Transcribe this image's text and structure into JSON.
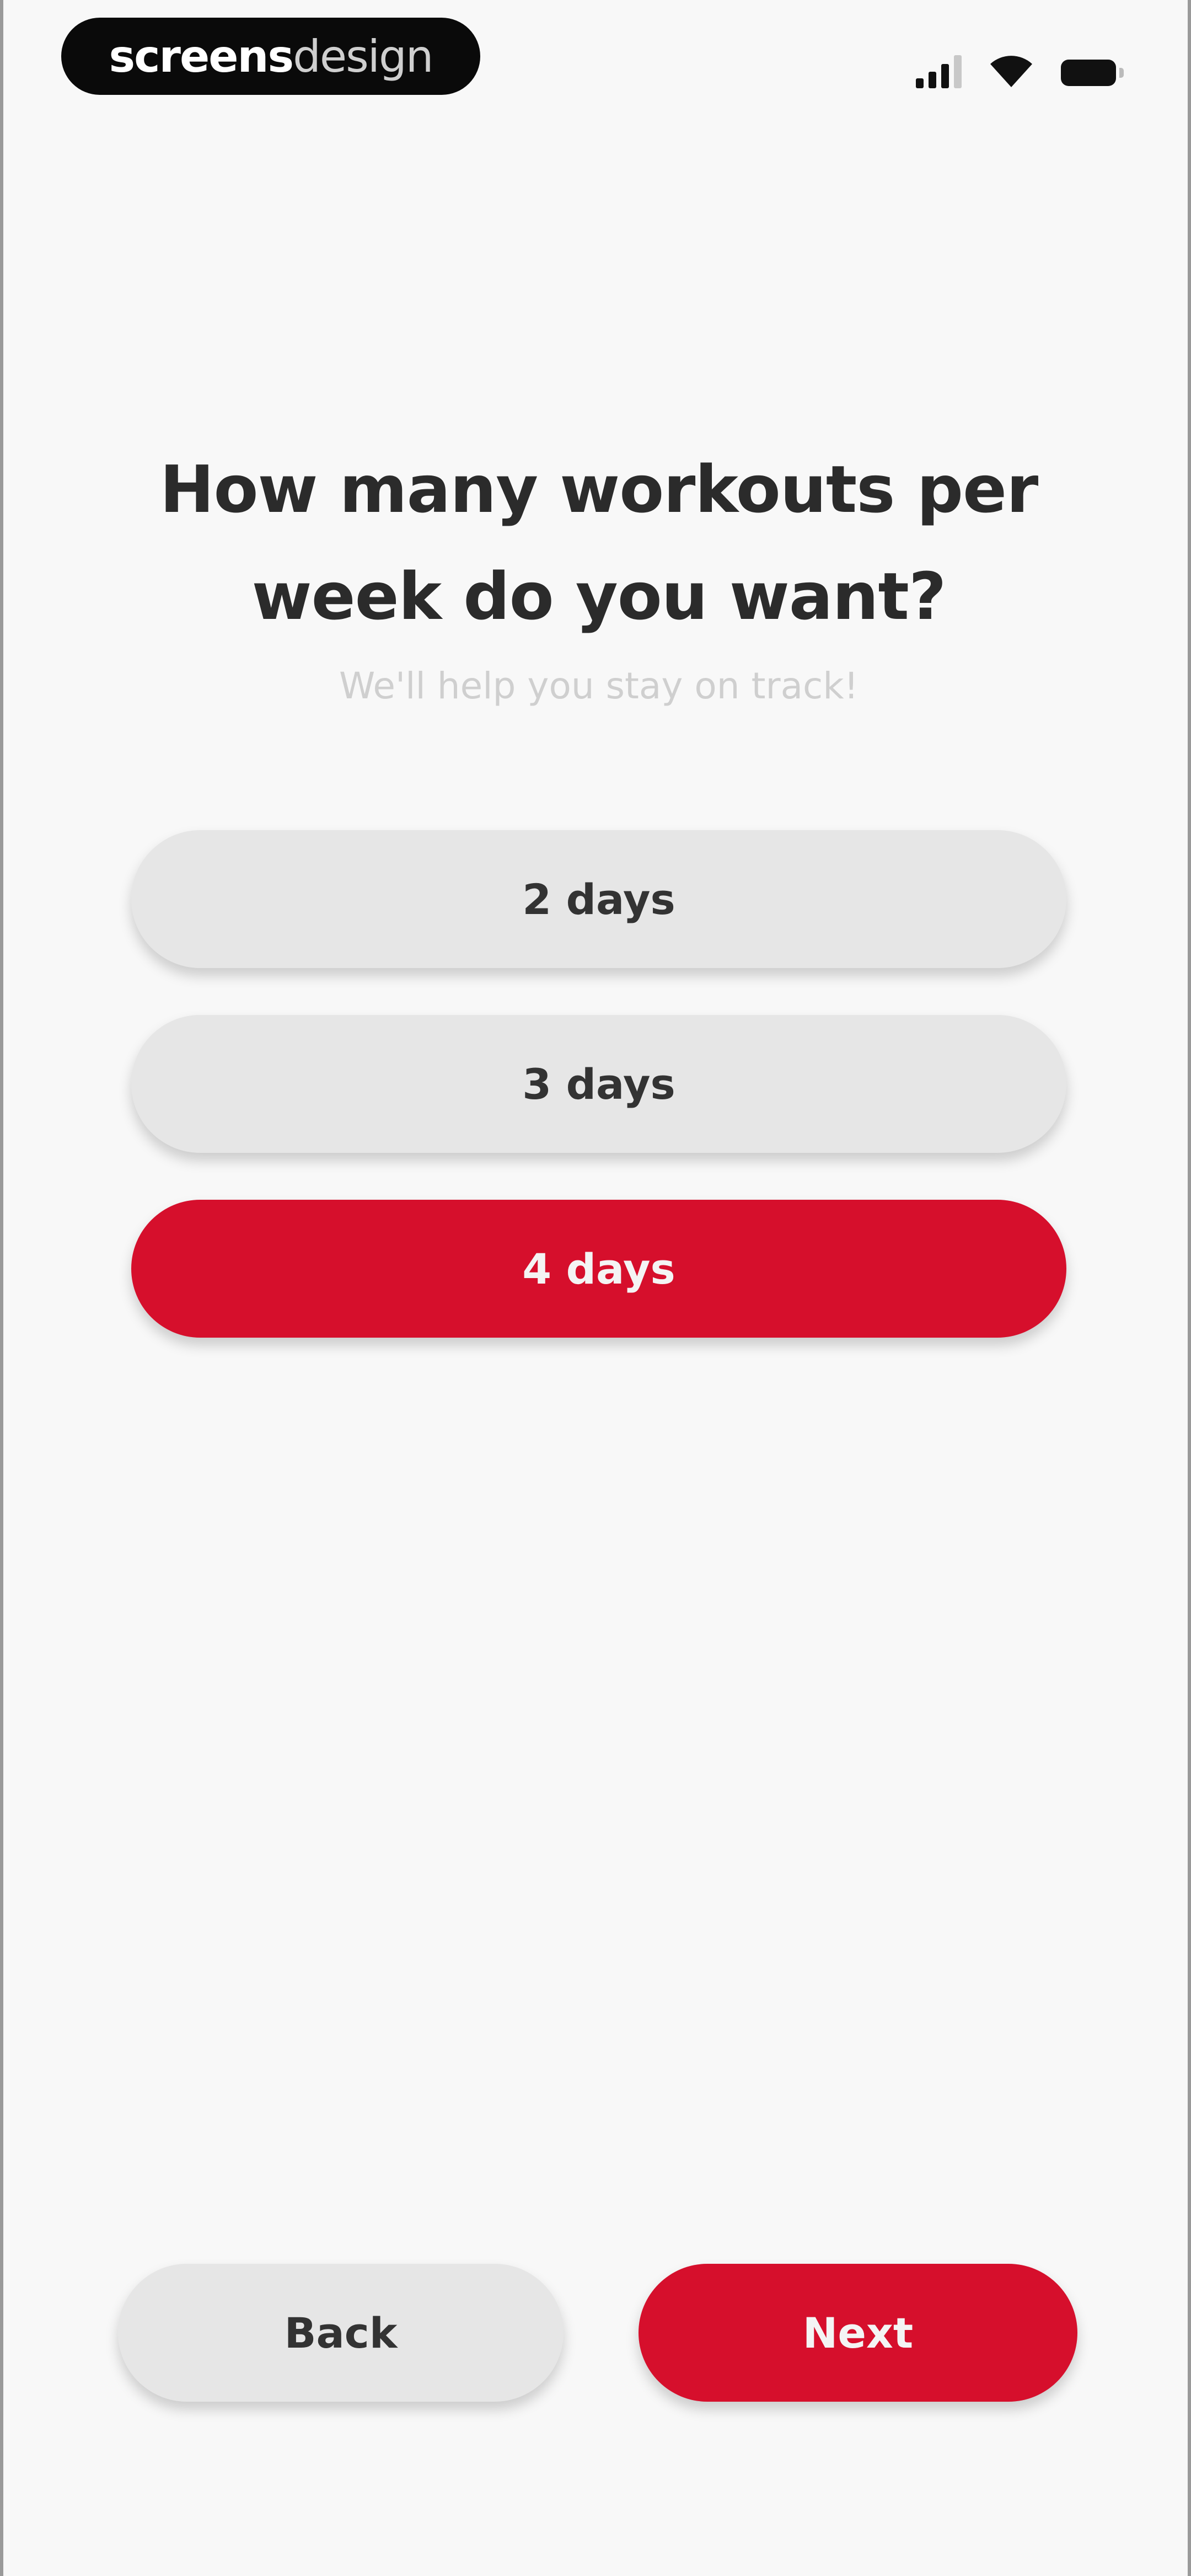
{
  "status_bar": {
    "brand_strong": "screens",
    "brand_light": "design",
    "icons": [
      "signal-icon",
      "wifi-icon",
      "battery-icon"
    ]
  },
  "question": {
    "title": "How many workouts per week do you want?",
    "subtitle": "We'll help you stay on track!"
  },
  "options": [
    {
      "label": "2 days",
      "selected": false
    },
    {
      "label": "3 days",
      "selected": false
    },
    {
      "label": "4 days",
      "selected": true
    }
  ],
  "footer": {
    "back_label": "Back",
    "next_label": "Next"
  },
  "colors": {
    "accent": "#d60f2c",
    "unselected_bg": "#e6e6e6",
    "background": "#f8f8f8",
    "title_text": "#2b2b2b",
    "subtitle_text": "#cfcfcf"
  }
}
